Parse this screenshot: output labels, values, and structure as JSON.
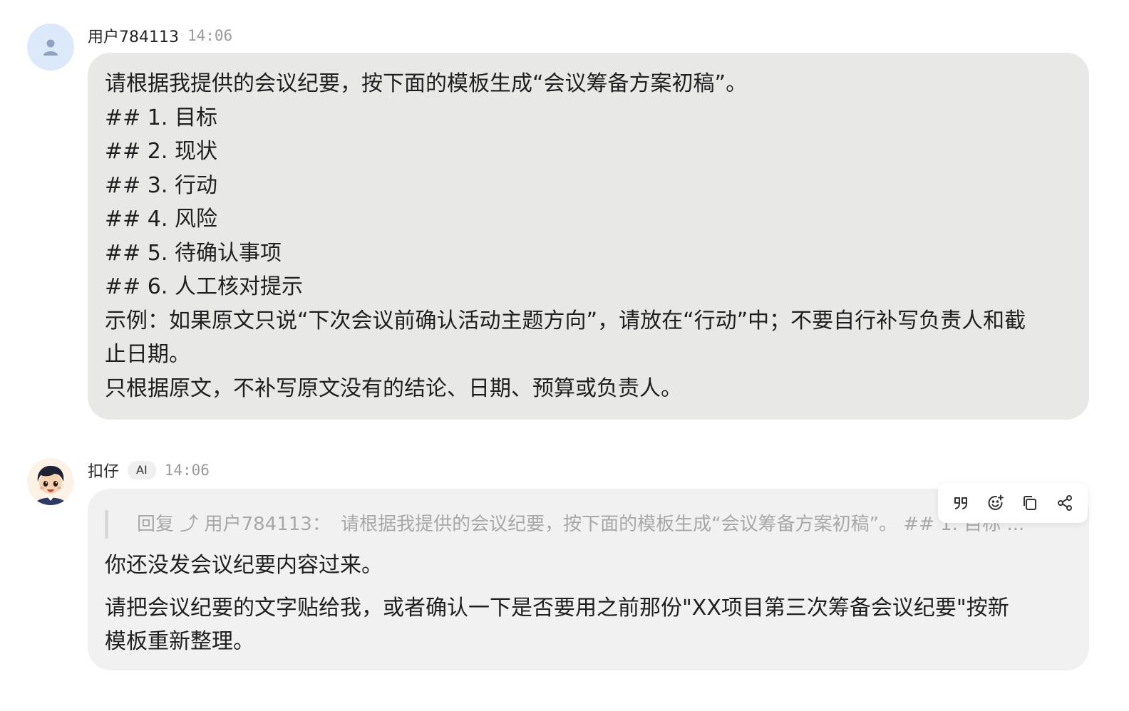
{
  "messages": [
    {
      "sender": "用户784113",
      "time": "14:06",
      "lines": [
        "请根据我提供的会议纪要，按下面的模板生成“会议筹备方案初稿”。",
        "## 1. 目标",
        "## 2. 现状",
        "## 3. 行动",
        "## 4. 风险",
        "## 5. 待确认事项",
        "## 6. 人工核对提示",
        "示例：如果原文只说“下次会议前确认活动主题方向”，请放在“行动”中；不要自行补写负责人和截",
        "止日期。",
        "只根据原文，不补写原文没有的结论、日期、预算或负责人。"
      ]
    },
    {
      "sender": "扣仔",
      "badge": "AI",
      "time": "14:06",
      "quote": {
        "prefix": "回复",
        "arrow": "⤴",
        "target": "用户784113：",
        "text": "请根据我提供的会议纪要，按下面的模板生成“会议筹备方案初稿”。 ## 1. 目标 ..."
      },
      "lines": [
        "你还没发会议纪要内容过来。",
        "请把会议纪要的文字贴给我，或者确认一下是否要用之前那份\"XX项目第三次筹备会议纪要\"按新",
        "模板重新整理。"
      ]
    }
  ],
  "toolbar": {
    "icons": [
      "quote-icon",
      "emoji-add-icon",
      "copy-icon",
      "share-icon"
    ]
  },
  "colors": {
    "user_bubble": "#e8e9e7",
    "ai_bubble": "#f1f1f1",
    "user_avatar_bg": "#dce9fb",
    "timestamp": "#9a9a9a"
  }
}
